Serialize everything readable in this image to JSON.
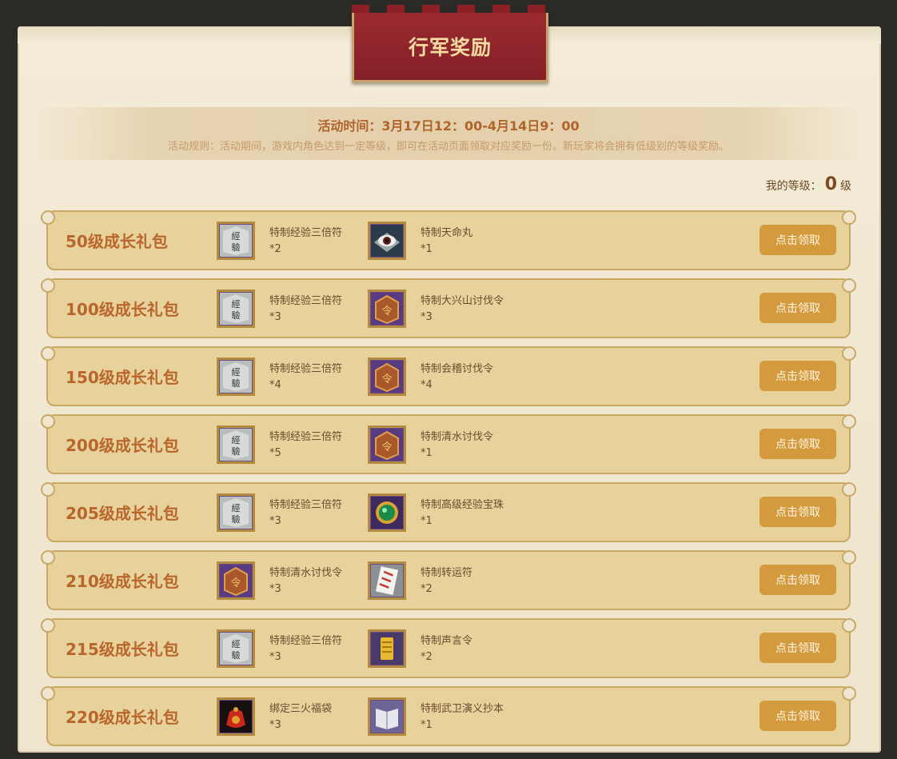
{
  "title": "行军奖励",
  "activity_time": "活动时间：3月17日12：00-4月14日9：00",
  "activity_rules": "活动规则：活动期间，游戏内角色达到一定等级，即可在活动页面领取对应奖励一份。新玩家将会拥有低级别的等级奖励。",
  "my_level": {
    "label": "我的等级：",
    "value": "0",
    "unit": "级"
  },
  "claim_label": "点击领取",
  "packages": [
    {
      "name": "50级成长礼包",
      "items": [
        {
          "name": "特制经验三倍符",
          "qty": "*2",
          "icon": "scroll-icon"
        },
        {
          "name": "特制天命丸",
          "qty": "*1",
          "icon": "eye-pill-icon"
        }
      ]
    },
    {
      "name": "100级成长礼包",
      "items": [
        {
          "name": "特制经验三倍符",
          "qty": "*3",
          "icon": "scroll-icon"
        },
        {
          "name": "特制大兴山讨伐令",
          "qty": "*3",
          "icon": "token-icon"
        }
      ]
    },
    {
      "name": "150级成长礼包",
      "items": [
        {
          "name": "特制经验三倍符",
          "qty": "*4",
          "icon": "scroll-icon"
        },
        {
          "name": "特制会稽讨伐令",
          "qty": "*4",
          "icon": "token-icon"
        }
      ]
    },
    {
      "name": "200级成长礼包",
      "items": [
        {
          "name": "特制经验三倍符",
          "qty": "*5",
          "icon": "scroll-icon"
        },
        {
          "name": "特制清水讨伐令",
          "qty": "*1",
          "icon": "token-icon"
        }
      ]
    },
    {
      "name": "205级成长礼包",
      "items": [
        {
          "name": "特制经验三倍符",
          "qty": "*3",
          "icon": "scroll-icon"
        },
        {
          "name": "特制高级经验宝珠",
          "qty": "*1",
          "icon": "orb-icon"
        }
      ]
    },
    {
      "name": "210级成长礼包",
      "items": [
        {
          "name": "特制清水讨伐令",
          "qty": "*3",
          "icon": "token-icon"
        },
        {
          "name": "特制转运符",
          "qty": "*2",
          "icon": "paper-talisman-icon"
        }
      ]
    },
    {
      "name": "215级成长礼包",
      "items": [
        {
          "name": "特制经验三倍符",
          "qty": "*3",
          "icon": "scroll-icon"
        },
        {
          "name": "特制声言令",
          "qty": "*2",
          "icon": "gold-scroll-icon"
        }
      ]
    },
    {
      "name": "220级成长礼包",
      "items": [
        {
          "name": "绑定三火福袋",
          "qty": "*3",
          "icon": "lucky-bag-icon"
        },
        {
          "name": "特制武卫演义抄本",
          "qty": "*1",
          "icon": "book-icon"
        }
      ]
    }
  ]
}
